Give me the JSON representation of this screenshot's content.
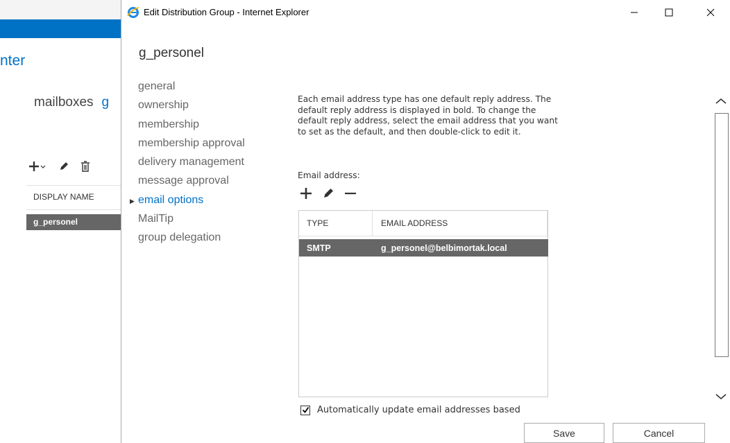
{
  "background": {
    "title_fragment": "nter",
    "tabs": {
      "mailboxes": "mailboxes",
      "cut": "g"
    },
    "table_header": "DISPLAY NAME",
    "selected_row": "g_personel"
  },
  "window": {
    "title": "Edit Distribution Group - Internet Explorer",
    "controls": {
      "minimize": "minimize-icon",
      "maximize": "maximize-icon",
      "close": "close-icon"
    }
  },
  "group_name": "g_personel",
  "nav": {
    "items": [
      {
        "label": "general"
      },
      {
        "label": "ownership"
      },
      {
        "label": "membership"
      },
      {
        "label": "membership approval"
      },
      {
        "label": "delivery management"
      },
      {
        "label": "message approval"
      },
      {
        "label": "email options"
      },
      {
        "label": "MailTip"
      },
      {
        "label": "group delegation"
      }
    ],
    "active_index": 6
  },
  "email_options": {
    "description": "Each email address type has one default reply address. The default reply address is displayed in bold. To change the default reply address, select the email address that you want to set as the default, and then double-click to edit it.",
    "email_label": "Email address:",
    "columns": [
      "TYPE",
      "EMAIL ADDRESS"
    ],
    "rows": [
      {
        "type": "SMTP",
        "address": "g_personel@belbimortak.local"
      }
    ],
    "checkbox_label": "Automatically update email addresses based",
    "checkbox_checked": true
  },
  "buttons": {
    "save": "Save",
    "cancel": "Cancel"
  },
  "colors": {
    "accent": "#0072c6",
    "selected_row": "#666666"
  }
}
